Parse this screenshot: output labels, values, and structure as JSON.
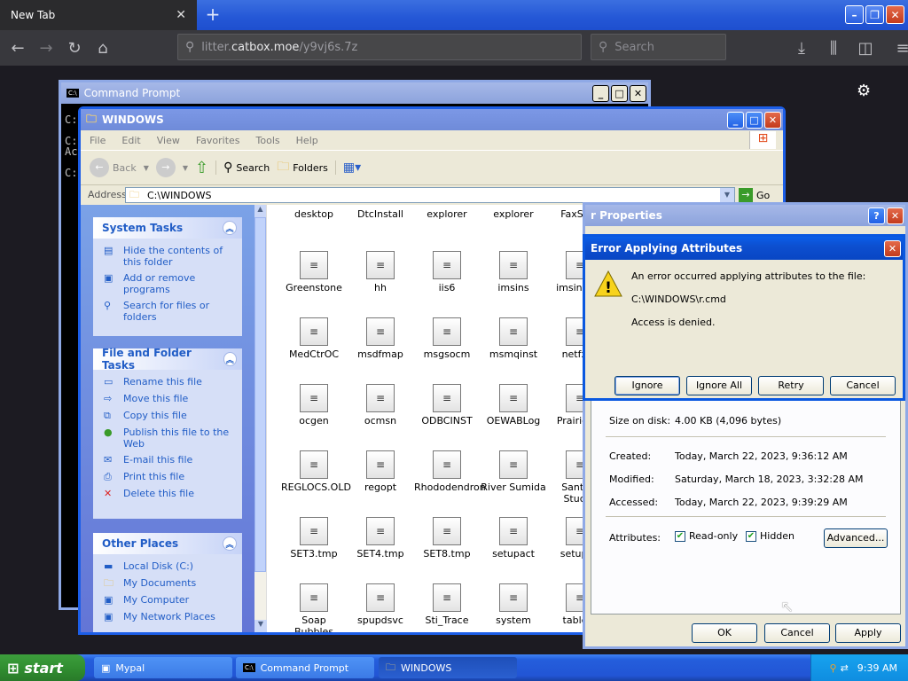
{
  "browser": {
    "tab_title": "New Tab",
    "url_prefix": "litter.",
    "url_domain": "catbox.moe",
    "url_path": "/y9vj6s.7z",
    "search_placeholder": "Search"
  },
  "cmd": {
    "title": "Command Prompt",
    "lines": [
      "C:",
      "C:",
      "Ac",
      "C:"
    ]
  },
  "explorer": {
    "title": "WINDOWS",
    "menu": [
      "File",
      "Edit",
      "View",
      "Favorites",
      "Tools",
      "Help"
    ],
    "toolbar": {
      "back": "Back",
      "search": "Search",
      "folders": "Folders"
    },
    "address_label": "Address",
    "address_value": "C:\\WINDOWS",
    "go_label": "Go",
    "system_tasks": {
      "title": "System Tasks",
      "items": [
        "Hide the contents of this folder",
        "Add or remove programs",
        "Search for files or folders"
      ]
    },
    "file_tasks": {
      "title": "File and Folder Tasks",
      "items": [
        "Rename this file",
        "Move this file",
        "Copy this file",
        "Publish this file to the Web",
        "E-mail this file",
        "Print this file",
        "Delete this file"
      ]
    },
    "other_places": {
      "title": "Other Places",
      "items": [
        "Local Disk (C:)",
        "My Documents",
        "My Computer",
        "My Network Places"
      ]
    },
    "files": [
      [
        "desktop",
        "DtcInstall",
        "explorer",
        "explorer",
        "FaxSetu"
      ],
      [
        "Greenstone",
        "hh",
        "iis6",
        "imsins",
        "imsins.BA"
      ],
      [
        "MedCtrOC",
        "msdfmap",
        "msgsocm",
        "msmqinst",
        "netfxoc"
      ],
      [
        "ocgen",
        "ocmsn",
        "ODBCINST",
        "OEWABLog",
        "Prairie Wi"
      ],
      [
        "REGLOCS.OLD",
        "regopt",
        "Rhododendron",
        "River Sumida",
        "Santa F Stucco"
      ],
      [
        "SET3.tmp",
        "SET4.tmp",
        "SET8.tmp",
        "setupact",
        "setupap"
      ],
      [
        "Soap Bubbles",
        "spupdsvc",
        "Sti_Trace",
        "system",
        "tableto"
      ]
    ]
  },
  "properties": {
    "title": "r Properties",
    "size_on_disk_label": "Size on disk:",
    "size_on_disk": "4.00 KB (4,096 bytes)",
    "created_label": "Created:",
    "created": "Today, March 22, 2023, 9:36:12 AM",
    "modified_label": "Modified:",
    "modified": "Saturday, March 18, 2023, 3:32:28 AM",
    "accessed_label": "Accessed:",
    "accessed": "Today, March 22, 2023, 9:39:29 AM",
    "attributes_label": "Attributes:",
    "readonly_label": "Read-only",
    "hidden_label": "Hidden",
    "advanced_label": "Advanced...",
    "ok": "OK",
    "cancel": "Cancel",
    "apply": "Apply"
  },
  "error_dialog": {
    "title": "Error Applying Attributes",
    "message": "An error occurred applying attributes to the file:",
    "path": "C:\\WINDOWS\\r.cmd",
    "detail": "Access is denied.",
    "ignore": "Ignore",
    "ignore_all": "Ignore All",
    "retry": "Retry",
    "cancel": "Cancel"
  },
  "taskbar": {
    "start": "start",
    "tasks": [
      "Mypal",
      "Command Prompt",
      "WINDOWS"
    ],
    "clock": "9:39 AM"
  }
}
